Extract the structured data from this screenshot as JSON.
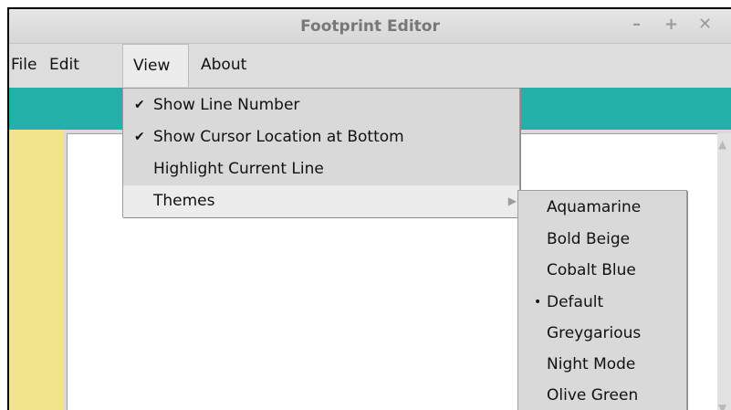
{
  "window": {
    "title": "Footprint Editor",
    "controls": {
      "minimize": "–",
      "maximize": "+",
      "close": "✕"
    }
  },
  "menubar": {
    "items": [
      {
        "label": "File"
      },
      {
        "label": "Edit"
      },
      {
        "label": "View"
      },
      {
        "label": "About"
      }
    ]
  },
  "view_menu": {
    "items": [
      {
        "label": "Show Line Number",
        "checked": true
      },
      {
        "label": "Show Cursor Location at Bottom",
        "checked": true
      },
      {
        "label": "Highlight Current Line",
        "checked": false
      },
      {
        "label": "Themes",
        "has_submenu": true
      }
    ],
    "check_glyph": "✔"
  },
  "themes_submenu": {
    "items": [
      {
        "label": "Aquamarine",
        "selected": false
      },
      {
        "label": "Bold Beige",
        "selected": false
      },
      {
        "label": "Cobalt Blue",
        "selected": false
      },
      {
        "label": "Default",
        "selected": true
      },
      {
        "label": "Greygarious",
        "selected": false
      },
      {
        "label": "Night Mode",
        "selected": false
      },
      {
        "label": "Olive Green",
        "selected": false
      }
    ],
    "radio_glyph": "•"
  },
  "colors": {
    "toolbar_accent": "#22b1a7",
    "gutter": "#f0e48c",
    "editor_bg": "#ffffff"
  }
}
